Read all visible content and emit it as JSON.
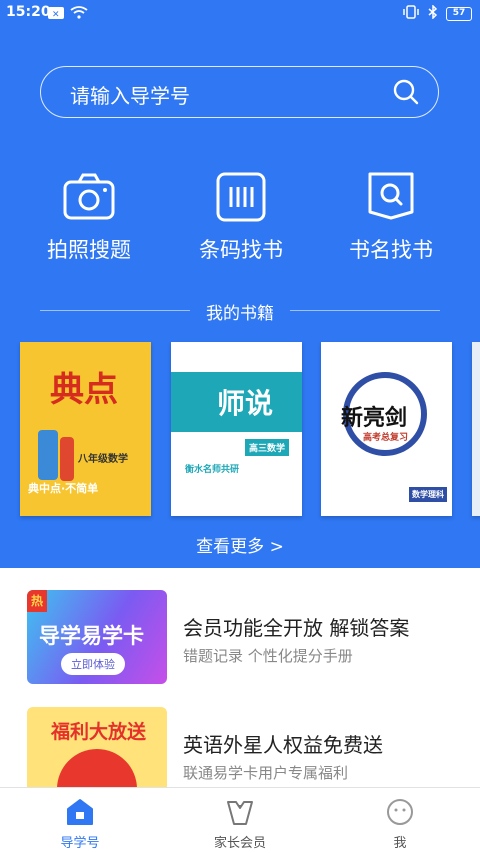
{
  "status": {
    "time": "15:20",
    "battery": "57"
  },
  "search": {
    "placeholder": "请输入导学号"
  },
  "tools": [
    {
      "label": "拍照搜题",
      "icon": "camera-icon"
    },
    {
      "label": "条码找书",
      "icon": "barcode-icon"
    },
    {
      "label": "书名找书",
      "icon": "book-search-icon"
    }
  ],
  "books_section": {
    "title": "我的书籍",
    "more": "查看更多 >"
  },
  "books": [
    {
      "cover_title": "典点",
      "cover_sub": "八年级数学",
      "cover_slogan": "典中点·不简单",
      "color": "#f7c52f"
    },
    {
      "cover_title": "师说",
      "cover_sub": "高三数学",
      "cover_slogan": "衡水名师共研",
      "color": "#1da7b7"
    },
    {
      "cover_title": "新亮剑",
      "cover_sub": "数学理科",
      "cover_slogan": "高考总复习",
      "color": "#2f4fa7"
    }
  ],
  "promos": [
    {
      "thumb_title": "导学易学卡",
      "thumb_button": "立即体验",
      "thumb_badge": "热",
      "title": "会员功能全开放 解锁答案",
      "subtitle": "错题记录 个性化提分手册"
    },
    {
      "thumb_title": "福利大放送",
      "title": "英语外星人权益免费送",
      "subtitle": "联通易学卡用户专属福利"
    }
  ],
  "tabs": [
    {
      "label": "导学号",
      "active": true
    },
    {
      "label": "家长会员",
      "active": false
    },
    {
      "label": "我",
      "active": false
    }
  ],
  "colors": {
    "primary": "#2f77f3",
    "text": "#222222",
    "muted": "#888888"
  }
}
